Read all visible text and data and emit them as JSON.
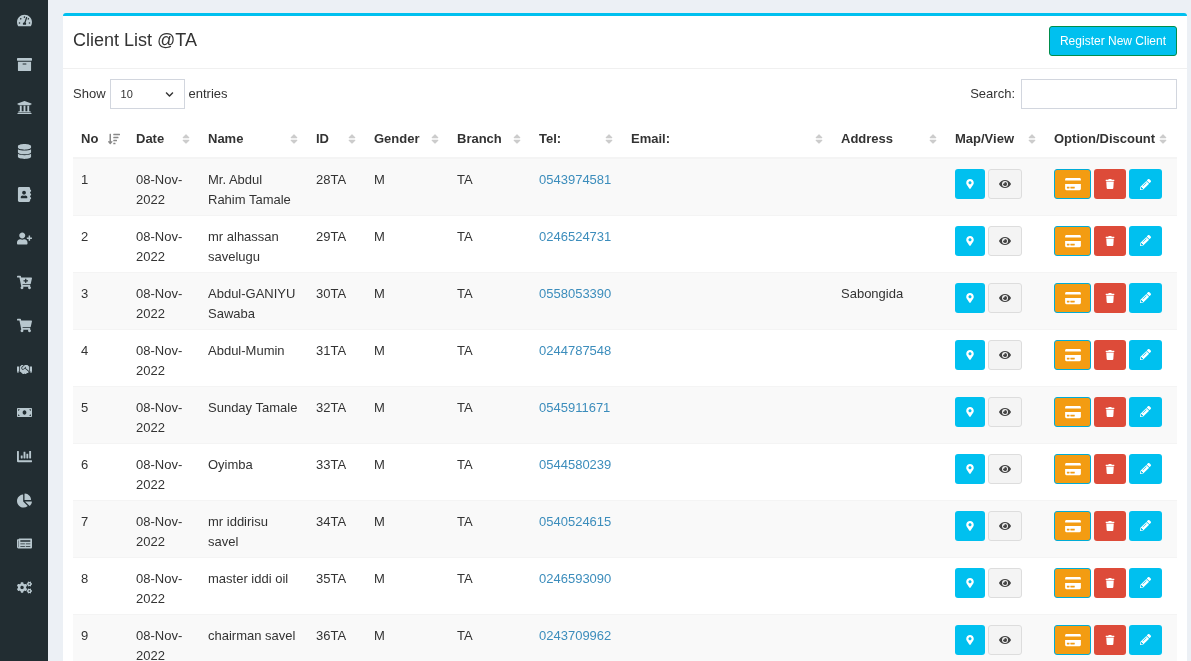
{
  "card": {
    "title": "Client List @TA",
    "register_button": "Register New Client"
  },
  "controls": {
    "show_label": "Show",
    "page_size": "10",
    "entries_label": "entries",
    "search_label": "Search:"
  },
  "table": {
    "columns": [
      {
        "label": "No",
        "sorted": true
      },
      {
        "label": "Date",
        "sorted": false
      },
      {
        "label": "Name",
        "sorted": false
      },
      {
        "label": "ID",
        "sorted": false
      },
      {
        "label": "Gender",
        "sorted": false
      },
      {
        "label": "Branch",
        "sorted": false
      },
      {
        "label": "Tel:",
        "sorted": false
      },
      {
        "label": "Email:",
        "sorted": false
      },
      {
        "label": "Address",
        "sorted": false
      },
      {
        "label": "Map/View",
        "sorted": false
      },
      {
        "label": "Option/Discount",
        "sorted": false
      }
    ],
    "rows": [
      {
        "no": "1",
        "date": "08-Nov-2022",
        "name": "Mr. Abdul Rahim Tamale",
        "id": "28TA",
        "gender": "M",
        "branch": "TA",
        "tel": "0543974581"
      },
      {
        "no": "2",
        "date": "08-Nov-2022",
        "name": "mr alhassan savelugu",
        "id": "29TA",
        "gender": "M",
        "branch": "TA",
        "tel": "0246524731"
      },
      {
        "no": "3",
        "date": "08-Nov-2022",
        "name": "Abdul-GANIYU Sawaba",
        "id": "30TA",
        "gender": "M",
        "branch": "TA",
        "tel": "0558053390",
        "address": "Sabongida"
      },
      {
        "no": "4",
        "date": "08-Nov-2022",
        "name": "Abdul-Mumin",
        "id": "31TA",
        "gender": "M",
        "branch": "TA",
        "tel": "0244787548"
      },
      {
        "no": "5",
        "date": "08-Nov-2022",
        "name": "Sunday Tamale",
        "id": "32TA",
        "gender": "M",
        "branch": "TA",
        "tel": "0545911671"
      },
      {
        "no": "6",
        "date": "08-Nov-2022",
        "name": "Oyimba",
        "id": "33TA",
        "gender": "M",
        "branch": "TA",
        "tel": "0544580239"
      },
      {
        "no": "7",
        "date": "08-Nov-2022",
        "name": "mr iddirisu savel",
        "id": "34TA",
        "gender": "M",
        "branch": "TA",
        "tel": "0540524615"
      },
      {
        "no": "8",
        "date": "08-Nov-2022",
        "name": "master iddi oil",
        "id": "35TA",
        "gender": "M",
        "branch": "TA",
        "tel": "0246593090"
      },
      {
        "no": "9",
        "date": "08-Nov-2022",
        "name": "chairman savel",
        "id": "36TA",
        "gender": "M",
        "branch": "TA",
        "tel": "0243709962"
      }
    ]
  }
}
